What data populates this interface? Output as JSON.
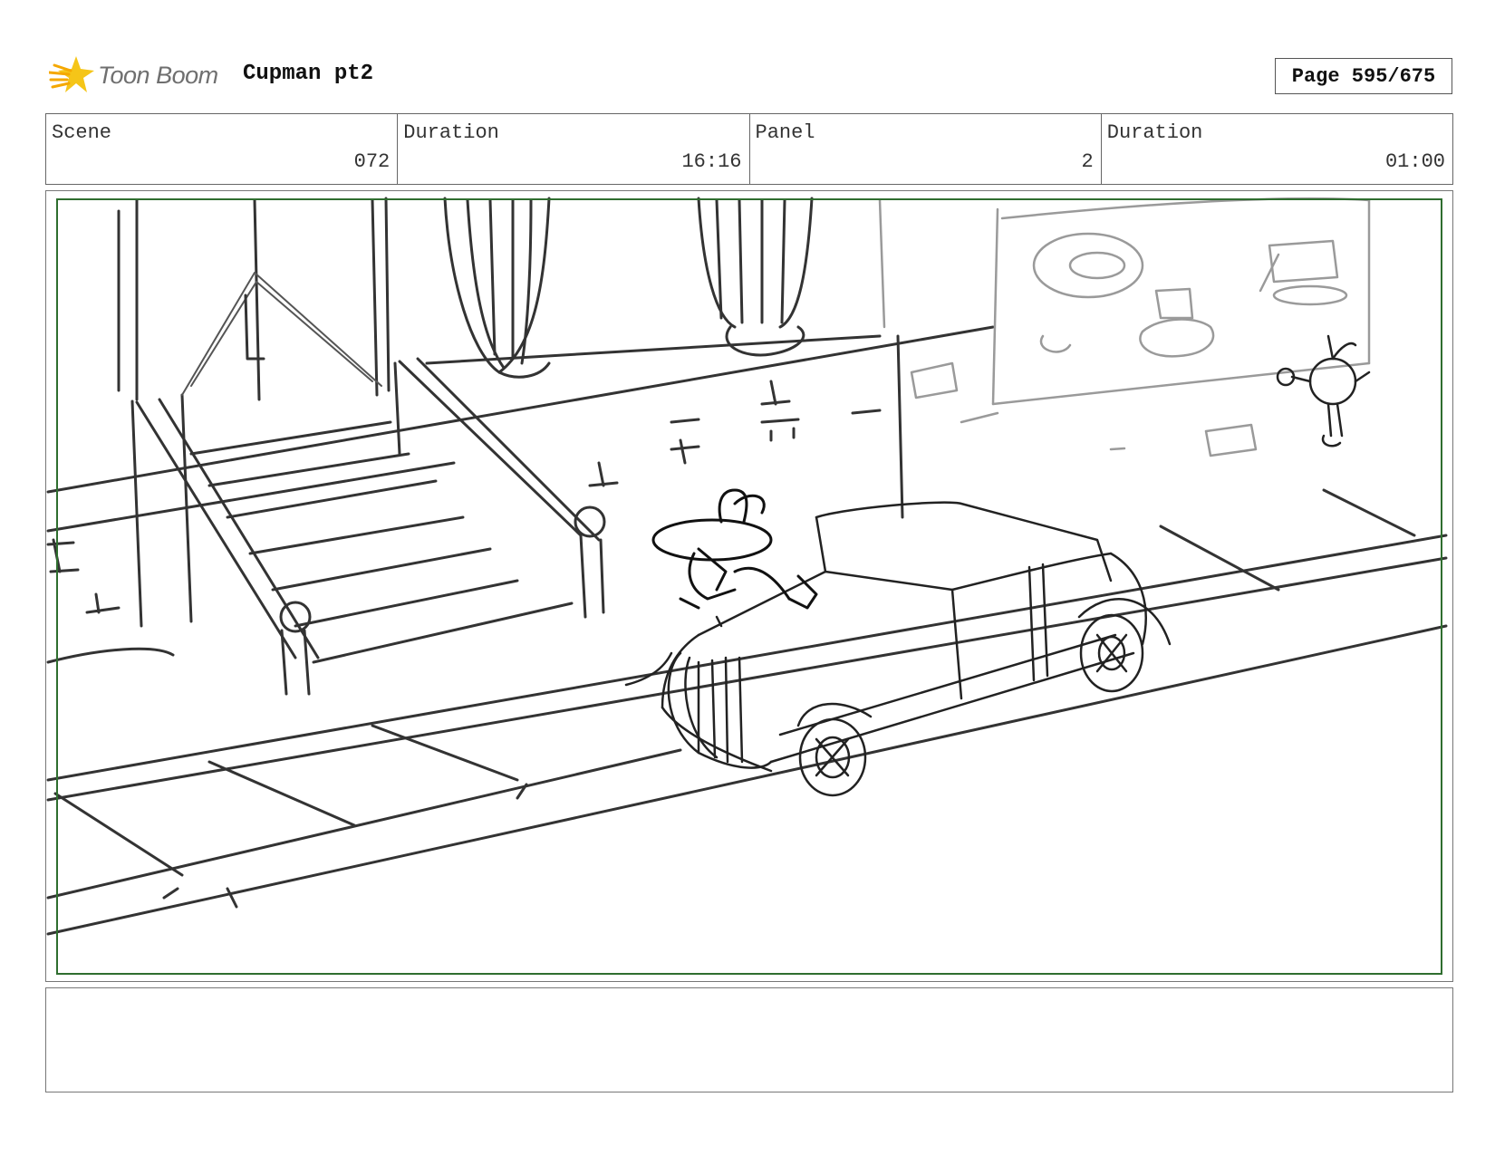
{
  "header": {
    "logo_text": "Toon Boom",
    "logo_icon": "comet-star-icon",
    "project_title": "Cupman pt2",
    "page_label": "Page 595/675"
  },
  "info": {
    "scene_label": "Scene",
    "scene_value": "072",
    "scene_duration_label": "Duration",
    "scene_duration_value": "16:16",
    "panel_label": "Panel",
    "panel_value": "2",
    "panel_duration_label": "Duration",
    "panel_duration_value": "01:00"
  },
  "panel": {
    "image": "storyboard-sketch-street-scene",
    "safe_area_color": "#2f6e2f"
  },
  "notes": {
    "text": ""
  },
  "colors": {
    "logo_accent": "#f5c518",
    "sketch_dark": "#333333",
    "sketch_light": "#9a9a9a"
  }
}
